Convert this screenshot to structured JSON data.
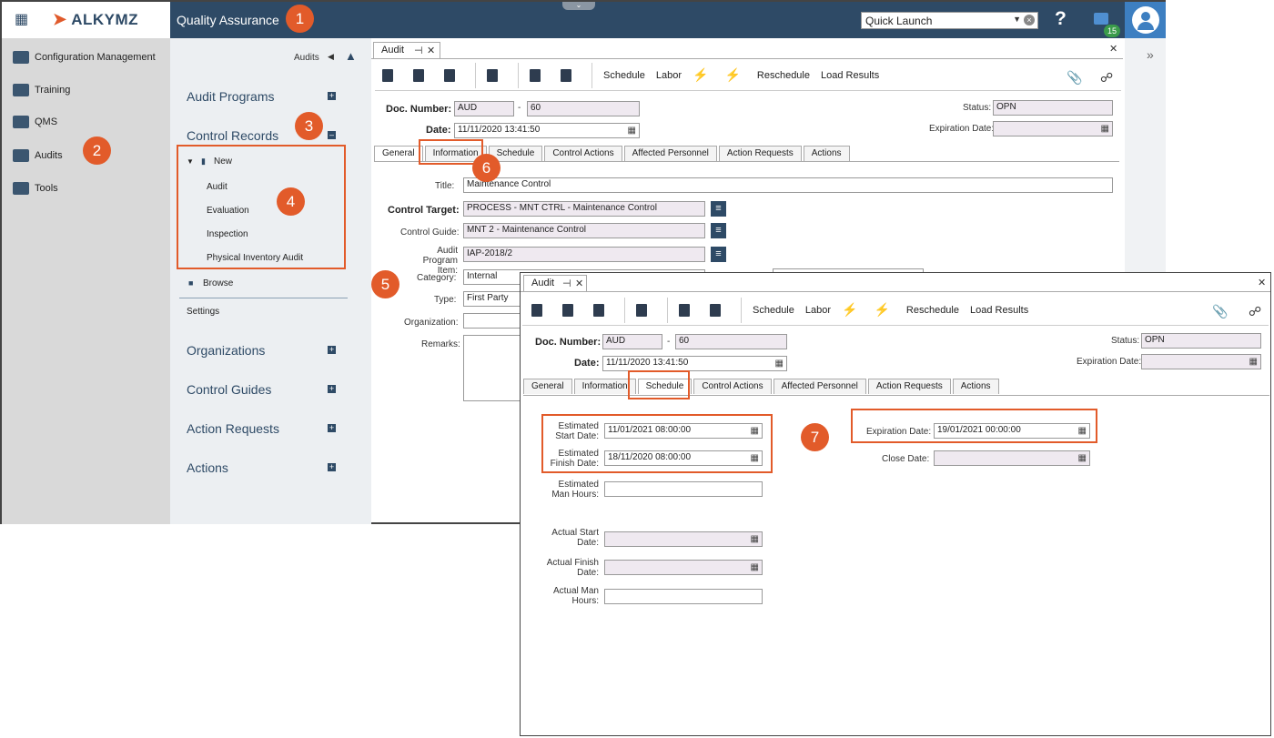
{
  "app": {
    "logo": "ALKYMZ",
    "module_title": "Quality Assurance",
    "quick_launch": "Quick Launch",
    "help": "?",
    "chat_badge": "15",
    "expand": "»"
  },
  "leftnav": [
    {
      "label": "Configuration Management",
      "icon": "config-icon"
    },
    {
      "label": "Training",
      "icon": "training-icon"
    },
    {
      "label": "QMS",
      "icon": "qms-icon"
    },
    {
      "label": "Audits",
      "icon": "audits-icon"
    },
    {
      "label": "Tools",
      "icon": "tools-icon"
    }
  ],
  "subnav": {
    "crumb": "Audits",
    "sections": [
      "Audit Programs",
      "Control Records",
      "Organizations",
      "Control Guides",
      "Action Requests",
      "Actions"
    ],
    "new_label": "New",
    "new_items": [
      "Audit",
      "Evaluation",
      "Inspection",
      "Physical Inventory Audit"
    ],
    "browse": "Browse",
    "settings": "Settings"
  },
  "form": {
    "tab_title": "Audit",
    "toolbar": [
      "Schedule",
      "Labor",
      "Reschedule",
      "Load Results"
    ],
    "doc_number_label": "Doc. Number:",
    "doc_prefix": "AUD",
    "doc_sep": "-",
    "doc_number": "60",
    "date_label": "Date:",
    "date_value": "11/11/2020 13:41:50",
    "status_label": "Status:",
    "status_value": "OPN",
    "expiration_label": "Expiration Date:",
    "tabs": [
      "General",
      "Information",
      "Schedule",
      "Control Actions",
      "Affected Personnel",
      "Action Requests",
      "Actions"
    ]
  },
  "general": {
    "title_label": "Title:",
    "title_value": "Maintenance Control",
    "control_target_label": "Control Target:",
    "control_target_value": "PROCESS - MNT CTRL - Maintenance Control",
    "control_guide_label": "Control Guide:",
    "control_guide_value": "MNT 2 - Maintenance Control",
    "api_label_1": "Audit Program",
    "api_label_2": "Item:",
    "api_value": "IAP-2018/2",
    "category_label": "Category:",
    "category_value": "Internal",
    "type_label": "Type:",
    "type_value": "First Party",
    "organization_label": "Organization:",
    "remarks_label": "Remarks:"
  },
  "schedule": {
    "est_start_1": "Estimated",
    "est_start_2": "Start Date:",
    "est_start_value": "11/01/2021 08:00:00",
    "est_finish_1": "Estimated",
    "est_finish_2": "Finish Date:",
    "est_finish_value": "18/11/2020 08:00:00",
    "est_hours_1": "Estimated",
    "est_hours_2": "Man Hours:",
    "act_start_1": "Actual Start",
    "act_start_2": "Date:",
    "act_finish_1": "Actual Finish",
    "act_finish_2": "Date:",
    "act_hours_1": "Actual Man",
    "act_hours_2": "Hours:",
    "expiration_label": "Expiration Date:",
    "expiration_value": "19/01/2021 00:00:00",
    "close_label": "Close Date:"
  },
  "callouts": [
    "1",
    "2",
    "3",
    "4",
    "5",
    "6",
    "7"
  ],
  "colors": {
    "accent": "#2e4a66",
    "callout": "#e25b2a",
    "avatar": "#3d7fc1"
  }
}
